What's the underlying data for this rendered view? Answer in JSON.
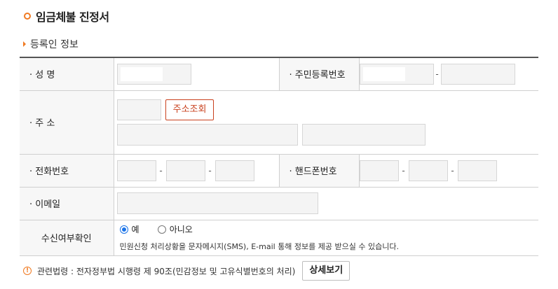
{
  "page_title": "임금체불 진정서",
  "section_title": "등록인 정보",
  "labels": {
    "name": "성 명",
    "rrn": "주민등록번호",
    "address": "주 소",
    "phone": "전화번호",
    "mobile": "핸드폰번호",
    "email": "이메일",
    "receive": "수신여부확인"
  },
  "address_search_label": "주소조회",
  "dash": "-",
  "radio_options": {
    "yes": "예",
    "no": "아니오",
    "selected": "예"
  },
  "receive_note": "민원신청 처리상황을 문자메시지(SMS), E-mail 통해 정보를 제공 받으실 수 있습니다.",
  "footer": {
    "law_text": "관련법령 : 전자정부법 시행령 제 90조(민감정보 및 고유식별번호의 처리)",
    "detail_label": "상세보기",
    "warn_glyph": "!"
  },
  "colors": {
    "accent": "#f07a22",
    "address_button": "#c9401d",
    "radio": "#1a73e8"
  }
}
